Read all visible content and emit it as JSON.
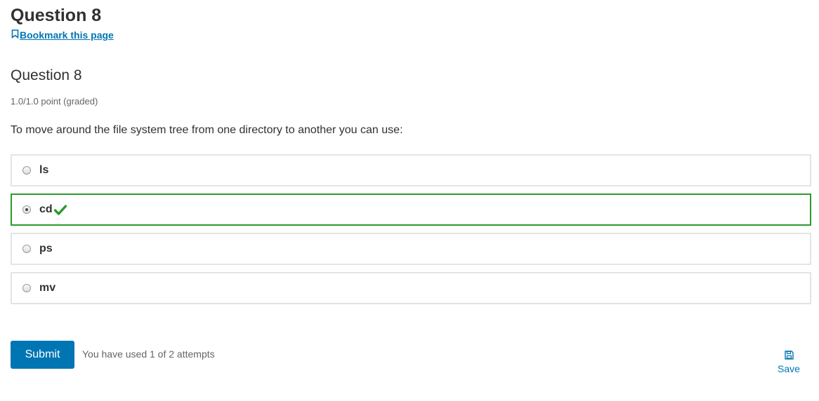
{
  "page": {
    "heading": "Question 8",
    "bookmark_label": "Bookmark this page"
  },
  "problem": {
    "title": "Question 8",
    "points": "1.0/1.0 point (graded)",
    "prompt": "To move around the file system tree from one directory to another you can use:",
    "options": [
      {
        "label": "ls",
        "selected": false,
        "correct": false
      },
      {
        "label": "cd",
        "selected": true,
        "correct": true
      },
      {
        "label": "ps",
        "selected": false,
        "correct": false
      },
      {
        "label": "mv",
        "selected": false,
        "correct": false
      }
    ]
  },
  "actions": {
    "submit_label": "Submit",
    "attempts_text": "You have used 1 of 2 attempts",
    "save_label": "Save"
  },
  "colors": {
    "link": "#0075b4",
    "correct": "#2b9a2b",
    "button_bg": "#0075b4"
  },
  "icons": {
    "bookmark": "bookmark-icon",
    "correct": "check-icon",
    "save": "save-icon"
  }
}
